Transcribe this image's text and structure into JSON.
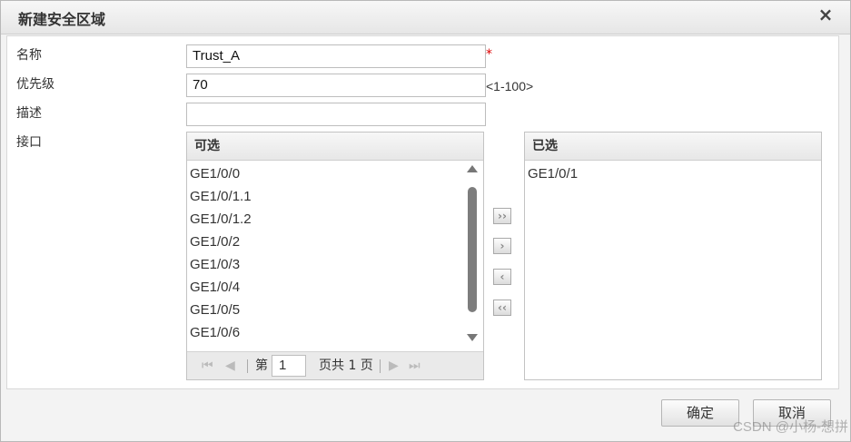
{
  "dialog": {
    "title": "新建安全区域",
    "close_glyph": "×"
  },
  "form": {
    "name_label": "名称",
    "name_value": "Trust_A",
    "required_mark": "*",
    "priority_label": "优先级",
    "priority_value": "70",
    "priority_hint": "<1-100>",
    "desc_label": "描述",
    "desc_value": "",
    "iface_label": "接口"
  },
  "available": {
    "header": "可选",
    "items": [
      "GE1/0/0",
      "GE1/0/1.1",
      "GE1/0/1.2",
      "GE1/0/2",
      "GE1/0/3",
      "GE1/0/4",
      "GE1/0/5",
      "GE1/0/6"
    ],
    "pager": {
      "first_icon": "first-page-icon",
      "prev_icon": "prev-page-icon",
      "page_prefix": "第",
      "page_value": "1",
      "page_suffix": "页共 1 页",
      "next_icon": "next-page-icon",
      "last_icon": "last-page-icon"
    }
  },
  "selected": {
    "header": "已选",
    "items": [
      "GE1/0/1"
    ]
  },
  "move_buttons": {
    "add_all": "››",
    "add": "›",
    "remove": "‹",
    "remove_all": "‹‹"
  },
  "footer": {
    "ok_label": "确定",
    "cancel_label": "取消"
  },
  "watermark": "CSDN @小杨-想拼"
}
